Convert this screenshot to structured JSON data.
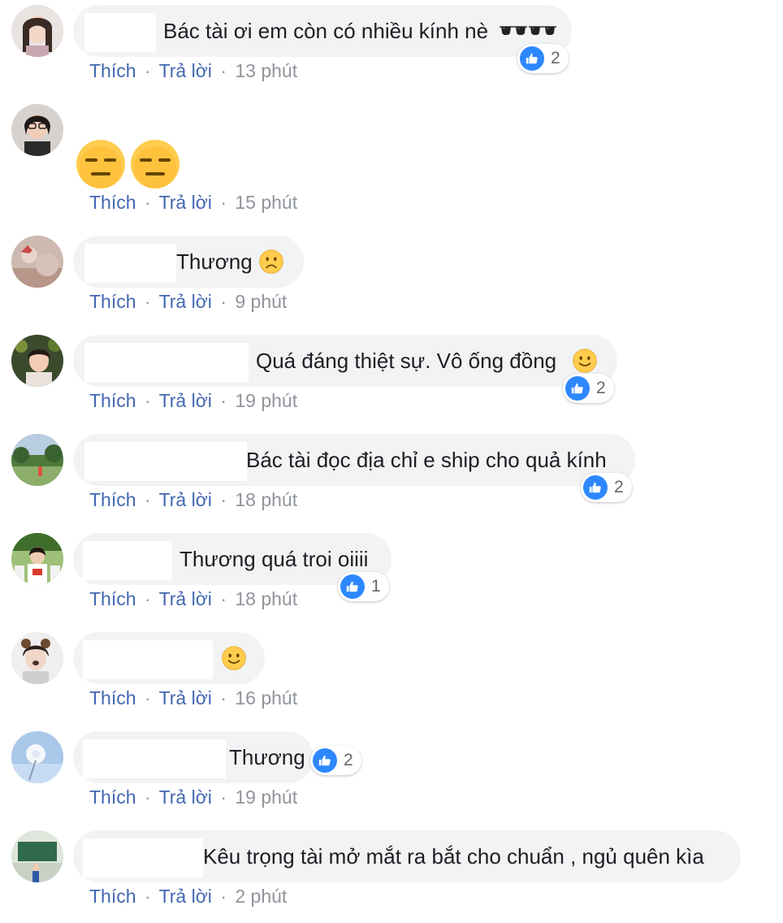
{
  "ui": {
    "like_label": "Thích",
    "reply_label": "Trả lời",
    "separator": "·"
  },
  "colors": {
    "bubble": "#f2f3f5",
    "link": "#4267b2",
    "meta": "#90949c",
    "like": "#2d88ff"
  },
  "comments": [
    {
      "text": "Bác tài ơi em còn có nhiều kính nè",
      "emoji": "sunglasses x2",
      "time": "13 phút",
      "reactions": "2"
    },
    {
      "text": "",
      "emoji": "expressionless-face x2",
      "time": "15 phút",
      "reactions": ""
    },
    {
      "text": "Thương",
      "emoji": "frowning-face",
      "time": "9 phút",
      "reactions": ""
    },
    {
      "text": "Quá đáng thiệt sự. Vô ống đồng",
      "emoji": "slightly-smiling-face",
      "time": "19 phút",
      "reactions": "2"
    },
    {
      "text": "Bác tài đọc địa chỉ e ship cho quả kính",
      "emoji": "",
      "time": "18 phút",
      "reactions": "2"
    },
    {
      "text": "Thương quá troi oiiii",
      "emoji": "",
      "time": "18 phút",
      "reactions": "1"
    },
    {
      "text": "",
      "emoji": "slightly-smiling-face",
      "time": "16 phút",
      "reactions": ""
    },
    {
      "text": "Thương",
      "emoji": "",
      "time": "19 phút",
      "reactions": "2"
    },
    {
      "text": "Kêu trọng tài mở mắt ra bắt cho chuẩn , ngủ quên kìa",
      "emoji": "",
      "time": "2 phút",
      "reactions": ""
    }
  ]
}
